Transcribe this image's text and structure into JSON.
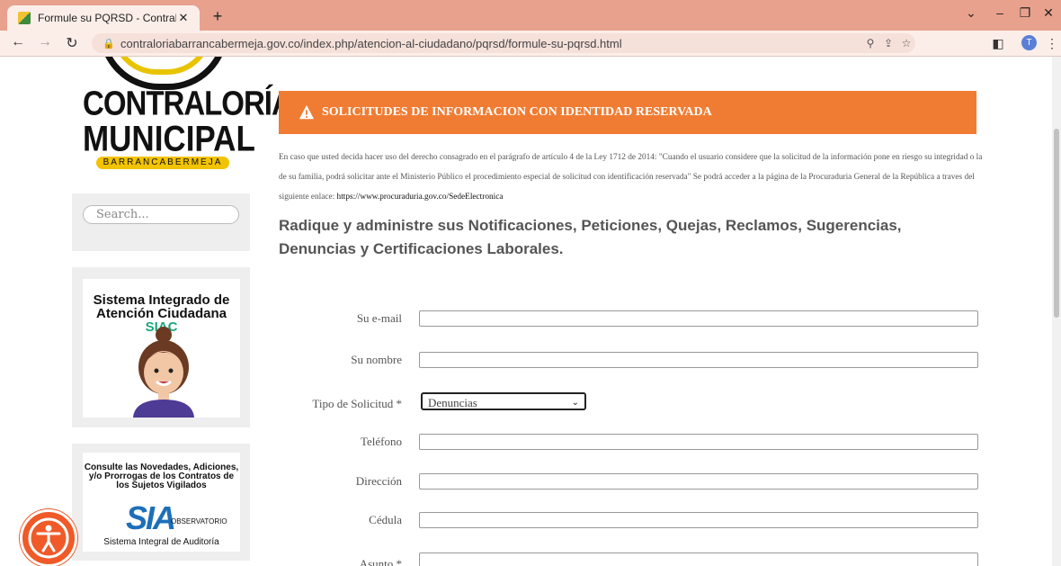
{
  "browser": {
    "tab_title": "Formule su PQRSD - Contraloría",
    "tab_close": "✕",
    "new_tab": "+",
    "url": "contraloriabarrancabermeja.gov.co/index.php/atencion-al-ciudadano/pqrsd/formule-su-pqrsd.html",
    "profile_initial": "T"
  },
  "logo": {
    "line1": "CONTRALORÍA",
    "line2": "MUNICIPAL",
    "line3": "BARRANCABERMEJA"
  },
  "sidebar": {
    "search_placeholder": "Search...",
    "siac_line1": "Sistema Integrado de",
    "siac_line2": "Atención Ciudadana",
    "siac_accent": "SIAC",
    "sia_text": "Consulte las Novedades, Adiciones, y/o Prorrogas de los Contratos de los Sujetos Vigilados",
    "sia_logo": "SIA",
    "sia_obs": "OBSERVATORIO",
    "sia_caption": "Sistema Integral de Auditoría"
  },
  "alert": {
    "text": "SOLICITUDES DE INFORMACION CON IDENTIDAD RESERVADA",
    "color": "#f07c33"
  },
  "notice": {
    "text": "En caso que usted decida hacer uso del derecho consagrado en el parágrafo de artículo 4 de la Ley 1712 de 2014: \"Cuando el usuario considere que la solicitud de la información pone en riesgo su integridad o la de su familia, podrá solicitar ante el Ministerio Público el procedimiento especial de solicitud con identificación reservada\" Se podrá acceder a la página de la Procuraduria General de la República a traves del siguiente enlace: ",
    "link": "https://www.procuraduria.gov.co/SedeElectronica"
  },
  "heading": "Radique y administre sus Notificaciones, Peticiones, Quejas, Reclamos, Sugerencias, Denuncias y Certificaciones Laborales.",
  "form": {
    "email_label": "Su e-mail",
    "name_label": "Su nombre",
    "type_label": "Tipo de Solicitud *",
    "type_value": "Denuncias",
    "phone_label": "Teléfono",
    "address_label": "Dirección",
    "id_label": "Cédula",
    "subject_label": "Asunto *"
  }
}
